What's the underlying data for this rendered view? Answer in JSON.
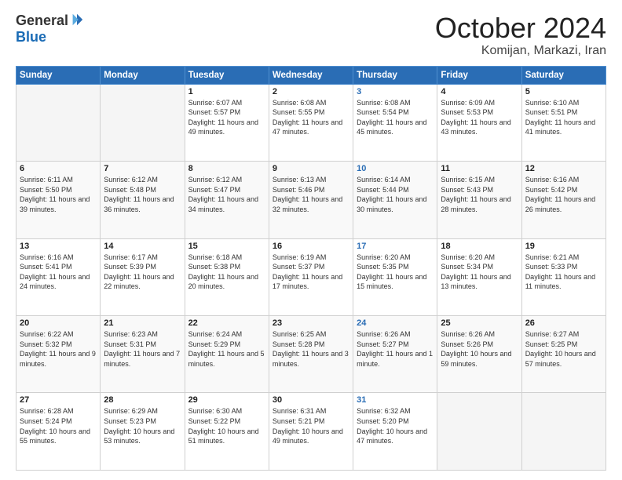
{
  "header": {
    "logo_general": "General",
    "logo_blue": "Blue",
    "month": "October 2024",
    "location": "Komijan, Markazi, Iran"
  },
  "weekdays": [
    "Sunday",
    "Monday",
    "Tuesday",
    "Wednesday",
    "Thursday",
    "Friday",
    "Saturday"
  ],
  "weeks": [
    [
      {
        "day": "",
        "info": ""
      },
      {
        "day": "",
        "info": ""
      },
      {
        "day": "1",
        "info": "Sunrise: 6:07 AM\nSunset: 5:57 PM\nDaylight: 11 hours and 49 minutes."
      },
      {
        "day": "2",
        "info": "Sunrise: 6:08 AM\nSunset: 5:55 PM\nDaylight: 11 hours and 47 minutes."
      },
      {
        "day": "3",
        "info": "Sunrise: 6:08 AM\nSunset: 5:54 PM\nDaylight: 11 hours and 45 minutes."
      },
      {
        "day": "4",
        "info": "Sunrise: 6:09 AM\nSunset: 5:53 PM\nDaylight: 11 hours and 43 minutes."
      },
      {
        "day": "5",
        "info": "Sunrise: 6:10 AM\nSunset: 5:51 PM\nDaylight: 11 hours and 41 minutes."
      }
    ],
    [
      {
        "day": "6",
        "info": "Sunrise: 6:11 AM\nSunset: 5:50 PM\nDaylight: 11 hours and 39 minutes."
      },
      {
        "day": "7",
        "info": "Sunrise: 6:12 AM\nSunset: 5:48 PM\nDaylight: 11 hours and 36 minutes."
      },
      {
        "day": "8",
        "info": "Sunrise: 6:12 AM\nSunset: 5:47 PM\nDaylight: 11 hours and 34 minutes."
      },
      {
        "day": "9",
        "info": "Sunrise: 6:13 AM\nSunset: 5:46 PM\nDaylight: 11 hours and 32 minutes."
      },
      {
        "day": "10",
        "info": "Sunrise: 6:14 AM\nSunset: 5:44 PM\nDaylight: 11 hours and 30 minutes."
      },
      {
        "day": "11",
        "info": "Sunrise: 6:15 AM\nSunset: 5:43 PM\nDaylight: 11 hours and 28 minutes."
      },
      {
        "day": "12",
        "info": "Sunrise: 6:16 AM\nSunset: 5:42 PM\nDaylight: 11 hours and 26 minutes."
      }
    ],
    [
      {
        "day": "13",
        "info": "Sunrise: 6:16 AM\nSunset: 5:41 PM\nDaylight: 11 hours and 24 minutes."
      },
      {
        "day": "14",
        "info": "Sunrise: 6:17 AM\nSunset: 5:39 PM\nDaylight: 11 hours and 22 minutes."
      },
      {
        "day": "15",
        "info": "Sunrise: 6:18 AM\nSunset: 5:38 PM\nDaylight: 11 hours and 20 minutes."
      },
      {
        "day": "16",
        "info": "Sunrise: 6:19 AM\nSunset: 5:37 PM\nDaylight: 11 hours and 17 minutes."
      },
      {
        "day": "17",
        "info": "Sunrise: 6:20 AM\nSunset: 5:35 PM\nDaylight: 11 hours and 15 minutes."
      },
      {
        "day": "18",
        "info": "Sunrise: 6:20 AM\nSunset: 5:34 PM\nDaylight: 11 hours and 13 minutes."
      },
      {
        "day": "19",
        "info": "Sunrise: 6:21 AM\nSunset: 5:33 PM\nDaylight: 11 hours and 11 minutes."
      }
    ],
    [
      {
        "day": "20",
        "info": "Sunrise: 6:22 AM\nSunset: 5:32 PM\nDaylight: 11 hours and 9 minutes."
      },
      {
        "day": "21",
        "info": "Sunrise: 6:23 AM\nSunset: 5:31 PM\nDaylight: 11 hours and 7 minutes."
      },
      {
        "day": "22",
        "info": "Sunrise: 6:24 AM\nSunset: 5:29 PM\nDaylight: 11 hours and 5 minutes."
      },
      {
        "day": "23",
        "info": "Sunrise: 6:25 AM\nSunset: 5:28 PM\nDaylight: 11 hours and 3 minutes."
      },
      {
        "day": "24",
        "info": "Sunrise: 6:26 AM\nSunset: 5:27 PM\nDaylight: 11 hours and 1 minute."
      },
      {
        "day": "25",
        "info": "Sunrise: 6:26 AM\nSunset: 5:26 PM\nDaylight: 10 hours and 59 minutes."
      },
      {
        "day": "26",
        "info": "Sunrise: 6:27 AM\nSunset: 5:25 PM\nDaylight: 10 hours and 57 minutes."
      }
    ],
    [
      {
        "day": "27",
        "info": "Sunrise: 6:28 AM\nSunset: 5:24 PM\nDaylight: 10 hours and 55 minutes."
      },
      {
        "day": "28",
        "info": "Sunrise: 6:29 AM\nSunset: 5:23 PM\nDaylight: 10 hours and 53 minutes."
      },
      {
        "day": "29",
        "info": "Sunrise: 6:30 AM\nSunset: 5:22 PM\nDaylight: 10 hours and 51 minutes."
      },
      {
        "day": "30",
        "info": "Sunrise: 6:31 AM\nSunset: 5:21 PM\nDaylight: 10 hours and 49 minutes."
      },
      {
        "day": "31",
        "info": "Sunrise: 6:32 AM\nSunset: 5:20 PM\nDaylight: 10 hours and 47 minutes."
      },
      {
        "day": "",
        "info": ""
      },
      {
        "day": "",
        "info": ""
      }
    ]
  ]
}
